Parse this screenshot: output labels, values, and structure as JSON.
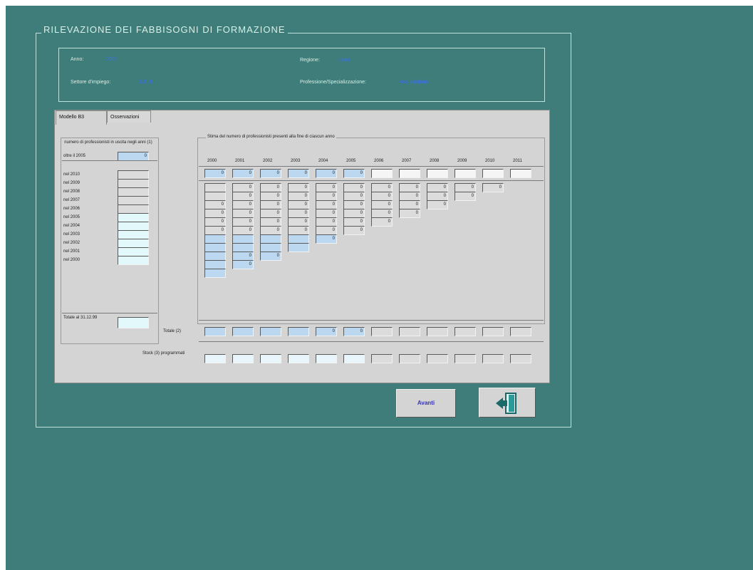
{
  "window": {
    "title": "RILEVAZIONE DEI FABBISOGNI DI FORMAZIONE"
  },
  "info": {
    "anno_label": "Anno:",
    "anno_value": "2005",
    "regione_label": "Regione:",
    "regione_value": "Lazio",
    "settore_label": "Settore d'impiego:",
    "settore_value": "S.S.N.",
    "professione_label": "Professione/Specializzazione:",
    "professione_value": "Ass.sanitaria"
  },
  "tabs": [
    {
      "label": "Modello B3"
    },
    {
      "label": "Osservazioni"
    }
  ],
  "left_table": {
    "header": "numero di professionisti in uscita negli anni (1)",
    "rows": [
      {
        "label": "oltre il 2005",
        "value": "0"
      },
      {
        "label": "nel 2010",
        "value": ""
      },
      {
        "label": "nel 2009",
        "value": ""
      },
      {
        "label": "nel 2008",
        "value": ""
      },
      {
        "label": "nel 2007",
        "value": ""
      },
      {
        "label": "nel 2006",
        "value": ""
      },
      {
        "label": "nel 2005",
        "value": ""
      },
      {
        "label": "nel 2004",
        "value": ""
      },
      {
        "label": "nel 2003",
        "value": ""
      },
      {
        "label": "nel 2002",
        "value": ""
      },
      {
        "label": "nel 2001",
        "value": ""
      },
      {
        "label": "nel 2000",
        "value": ""
      }
    ],
    "total_label": "Totale al 31.12.99",
    "total_value": ""
  },
  "estimate": {
    "header": "Stima del numero di professionisti presenti alla fine di ciascun anno",
    "years": [
      "2000",
      "2001",
      "2002",
      "2003",
      "2004",
      "2005",
      "2006",
      "2007",
      "2008",
      "2009",
      "2010",
      "2011"
    ],
    "top_row": [
      "0",
      "0",
      "0",
      "0",
      "0",
      "0",
      "",
      "",
      "",
      "",
      "",
      ""
    ],
    "matrix": [
      [
        "",
        "0",
        "0",
        "0",
        "0",
        "0",
        "0",
        "0",
        "0",
        "0",
        "0"
      ],
      [
        "",
        "0",
        "0",
        "0",
        "0",
        "0",
        "0",
        "0",
        "0",
        "0"
      ],
      [
        "0",
        "0",
        "0",
        "0",
        "0",
        "0",
        "0",
        "0",
        "0"
      ],
      [
        "0",
        "0",
        "0",
        "0",
        "0",
        "0",
        "0",
        "0"
      ],
      [
        "0",
        "0",
        "0",
        "0",
        "0",
        "0",
        "0"
      ],
      [
        "0",
        "0",
        "0",
        "0",
        "0",
        "0"
      ],
      [
        "",
        "",
        "",
        "",
        "0"
      ],
      [
        "",
        "",
        "",
        ""
      ],
      [
        "",
        "0",
        "0"
      ],
      [
        "",
        "0"
      ],
      [
        ""
      ]
    ],
    "total_label": "Totale (2)",
    "total_row": [
      "",
      "",
      "",
      "",
      "0",
      "0",
      "",
      "",
      "",
      "",
      "",
      ""
    ],
    "stock_label": "Stock (3) programmati",
    "stock_row": [
      "",
      "",
      "",
      "",
      "",
      "",
      "",
      "",
      "",
      "",
      "",
      ""
    ]
  },
  "buttons": {
    "avanti": "Avanti"
  },
  "colors": {
    "background": "#3f7d7a",
    "panel": "#d4d4d4",
    "value_text": "#3a6cff",
    "cell_blue": "#bcd8f0"
  }
}
